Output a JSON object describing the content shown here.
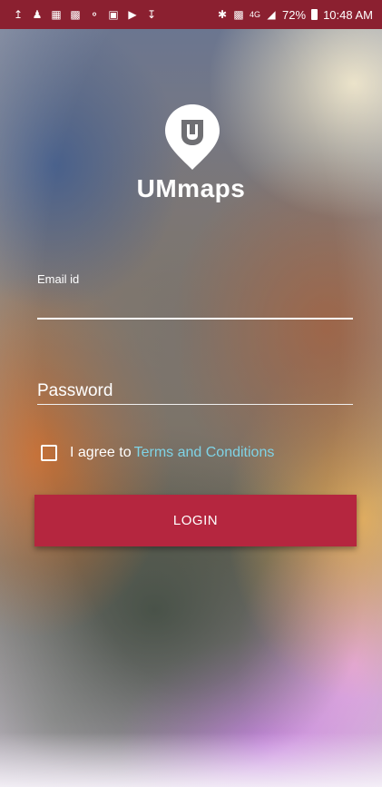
{
  "status_bar": {
    "icons_left": [
      "upload-icon",
      "person-icon",
      "image-icon",
      "calendar-icon",
      "lock-icon",
      "gallery-icon",
      "video-icon",
      "download-icon"
    ],
    "icons_right": [
      "bluetooth-icon",
      "nfc-icon",
      "signal-icon",
      "battery-icon"
    ],
    "network": "4G",
    "battery": "72%",
    "time": "10:48 AM",
    "bar_color": "#8b2030"
  },
  "app": {
    "brand_name": "UMmaps",
    "logo_icon": "umaps-pin-logo-icon"
  },
  "form": {
    "email_label": "Email id",
    "email_value": "",
    "password_placeholder": "Password",
    "password_value": "",
    "terms_prefix": "I agree to",
    "terms_link": "Terms and Conditions",
    "terms_checked": false,
    "login_label": "LOGIN"
  },
  "colors": {
    "accent": "#b5263f",
    "link": "#7fd3e6"
  }
}
